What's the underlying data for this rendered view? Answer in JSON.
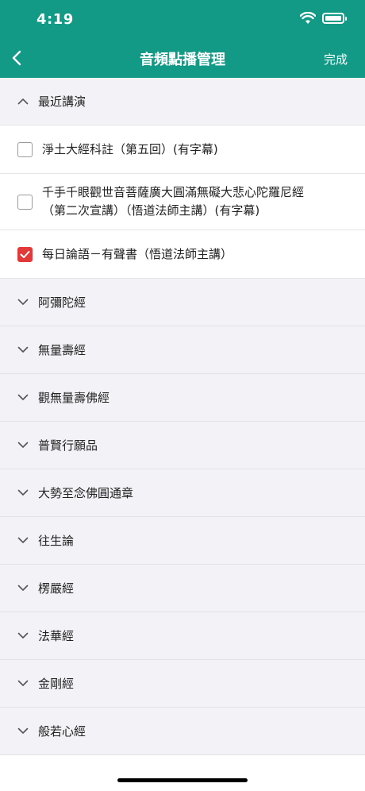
{
  "status": {
    "time": "4:19"
  },
  "nav": {
    "title": "音頻點播管理",
    "done": "完成"
  },
  "sections": [
    {
      "label": "最近講演",
      "expanded": true
    },
    {
      "label": "阿彌陀經"
    },
    {
      "label": "無量壽經"
    },
    {
      "label": "觀無量壽佛經"
    },
    {
      "label": "普賢行願品"
    },
    {
      "label": "大勢至念佛圓通章"
    },
    {
      "label": "往生論"
    },
    {
      "label": "楞嚴經"
    },
    {
      "label": "法華經"
    },
    {
      "label": "金剛經"
    },
    {
      "label": "般若心經"
    }
  ],
  "recent_items": [
    {
      "line1": "淨土大經科註（第五回）(有字幕)",
      "checked": false
    },
    {
      "line1": "千手千眼觀世音菩薩廣大圓滿無礙大悲心陀羅尼經",
      "line2": "（第二次宣講）（悟道法師主講）(有字幕)",
      "checked": false
    },
    {
      "line1": "每日論語－有聲書（悟道法師主講）",
      "checked": true
    }
  ],
  "colors": {
    "header": "#139a86",
    "checked": "#e23a3a",
    "list_bg": "#f2f2f7"
  }
}
